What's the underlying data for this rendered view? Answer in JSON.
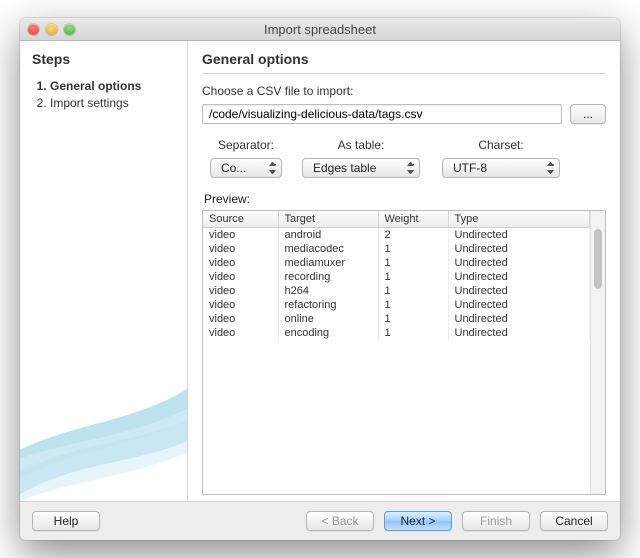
{
  "window": {
    "title": "Import spreadsheet"
  },
  "sidebar": {
    "heading": "Steps",
    "items": [
      {
        "label": "General options"
      },
      {
        "label": "Import settings"
      }
    ]
  },
  "main": {
    "heading": "General options",
    "file_label": "Choose a CSV file to import:",
    "file_path": "/code/visualizing-delicious-data/tags.csv",
    "browse_label": "...",
    "controls": {
      "separator": {
        "label": "Separator:",
        "value": "Co..."
      },
      "as_table": {
        "label": "As table:",
        "value": "Edges table"
      },
      "charset": {
        "label": "Charset:",
        "value": "UTF-8"
      }
    },
    "preview_label": "Preview:",
    "preview": {
      "columns": [
        "Source",
        "Target",
        "Weight",
        "Type"
      ],
      "rows": [
        [
          "video",
          "android",
          "2",
          "Undirected"
        ],
        [
          "video",
          "mediacodec",
          "1",
          "Undirected"
        ],
        [
          "video",
          "mediamuxer",
          "1",
          "Undirected"
        ],
        [
          "video",
          "recording",
          "1",
          "Undirected"
        ],
        [
          "video",
          "h264",
          "1",
          "Undirected"
        ],
        [
          "video",
          "refactoring",
          "1",
          "Undirected"
        ],
        [
          "video",
          "online",
          "1",
          "Undirected"
        ],
        [
          "video",
          "encoding",
          "1",
          "Undirected"
        ]
      ]
    }
  },
  "footer": {
    "help": "Help",
    "back": "< Back",
    "next": "Next >",
    "finish": "Finish",
    "cancel": "Cancel"
  }
}
